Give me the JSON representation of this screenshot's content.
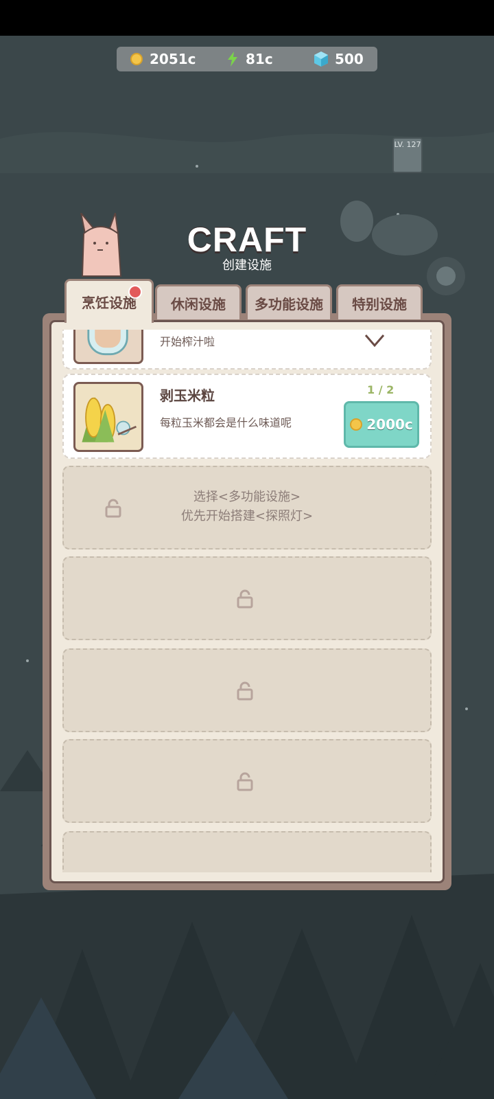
{
  "currency": {
    "coins": "2051c",
    "energy": "81c",
    "gems": "500"
  },
  "title": "CRAFT",
  "subtitle": "创建设施",
  "level_sign": "LV. 127",
  "tabs": [
    {
      "label": "烹饪设施",
      "active": true,
      "has_notification": true
    },
    {
      "label": "休闲设施",
      "active": false
    },
    {
      "label": "多功能设施",
      "active": false
    },
    {
      "label": "特别设施",
      "active": false
    }
  ],
  "cards": [
    {
      "desc": "开始榨汁啦",
      "status": "completed"
    },
    {
      "title": "剥玉米粒",
      "desc": "每粒玉米都会是什么味道呢",
      "count": "1 / 2",
      "price": "2000c"
    }
  ],
  "locked_slots": [
    {
      "hint_line1": "选择<多功能设施>",
      "hint_line2": "优先开始搭建<探照灯>"
    },
    {},
    {},
    {}
  ],
  "colors": {
    "accent_teal": "#7fd6c7",
    "panel_bg": "#f0e9dd",
    "notification_red": "#e25a5a"
  }
}
